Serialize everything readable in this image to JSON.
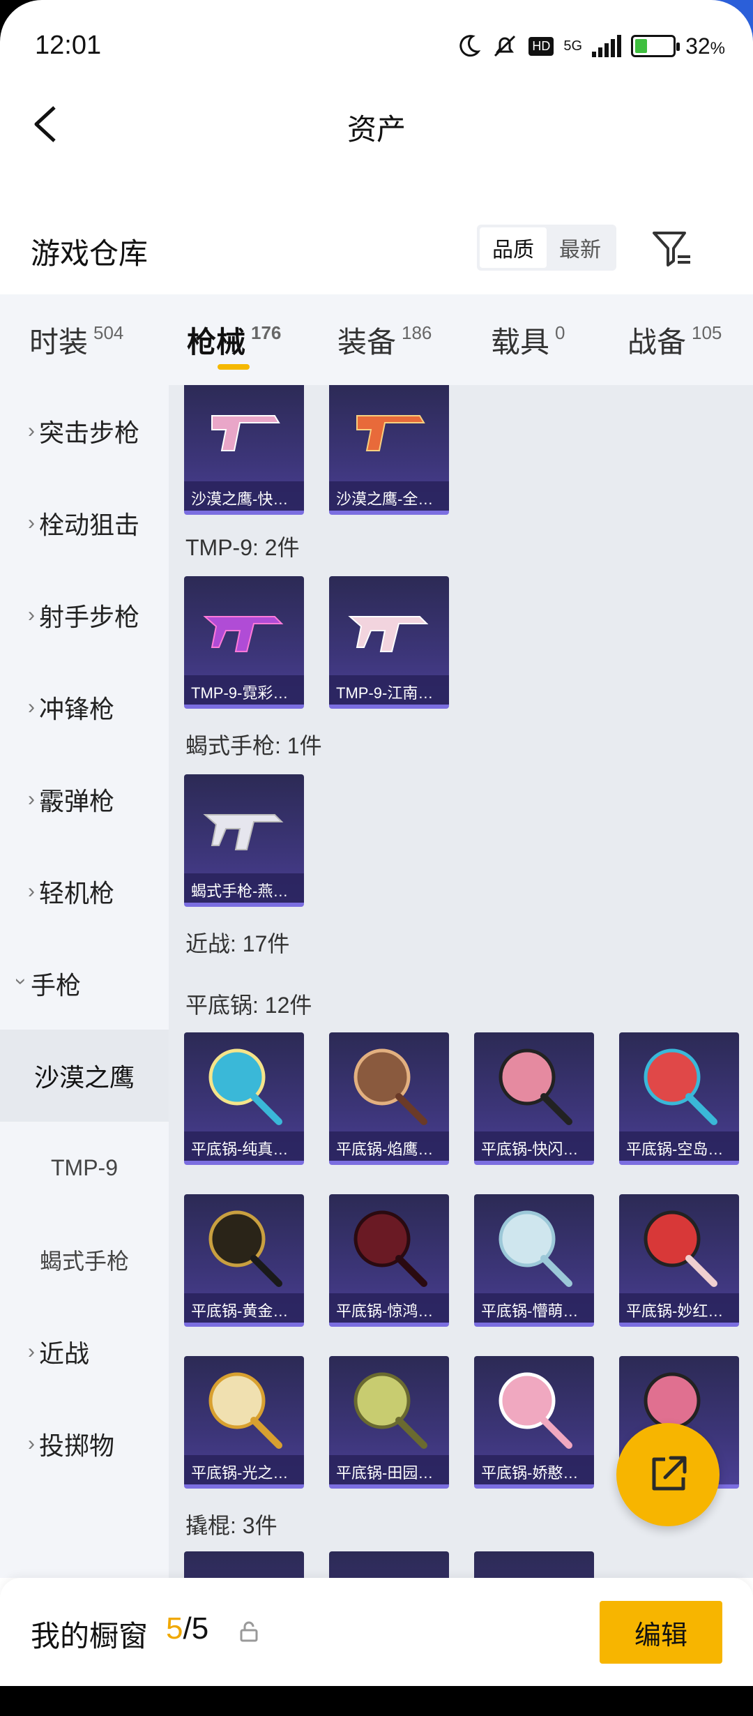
{
  "status_bar": {
    "time": "12:01",
    "network": "5G",
    "hd": "HD",
    "battery": "32",
    "battery_unit": "%"
  },
  "header": {
    "title": "资产"
  },
  "warehouse": {
    "title": "游戏仓库",
    "sort_options": [
      "品质",
      "最新"
    ]
  },
  "tabs": [
    {
      "label": "时装",
      "count": "504"
    },
    {
      "label": "枪械",
      "count": "176"
    },
    {
      "label": "装备",
      "count": "186"
    },
    {
      "label": "载具",
      "count": "0"
    },
    {
      "label": "战备",
      "count": "105"
    }
  ],
  "sidebar": {
    "categories": [
      "突击步枪",
      "栓动狙击",
      "射手步枪",
      "冲锋枪",
      "霰弹枪",
      "轻机枪",
      "手枪"
    ],
    "subcategories": [
      "沙漠之鹰",
      "TMP-9",
      "蝎式手枪"
    ],
    "more": [
      "近战",
      "投掷物"
    ]
  },
  "content": {
    "deagle_items": [
      "沙漠之鹰-快…",
      "沙漠之鹰-全…"
    ],
    "tmp_header": "TMP-9: 2件",
    "tmp_items": [
      "TMP-9-霓彩…",
      "TMP-9-江南…"
    ],
    "scorpion_header": "蝎式手枪: 1件",
    "scorpion_items": [
      "蝎式手枪-燕…"
    ],
    "melee_header": "近战: 17件",
    "pan_header": "平底锅: 12件",
    "pan_items": [
      "平底锅-纯真…",
      "平底锅-焰鹰…",
      "平底锅-快闪…",
      "平底锅-空岛…",
      "平底锅-黄金…",
      "平底锅-惊鸿…",
      "平底锅-懵萌…",
      "平底锅-妙红…",
      "平底锅-光之…",
      "平底锅-田园…",
      "平底锅-娇憨…"
    ],
    "crowbar_header": "撬棍: 3件"
  },
  "bottom": {
    "label": "我的橱窗",
    "count_current": "5",
    "count_total": "/5",
    "edit_label": "编辑"
  },
  "colors": {
    "accent": "#f7b500",
    "card": "#3c3578"
  }
}
